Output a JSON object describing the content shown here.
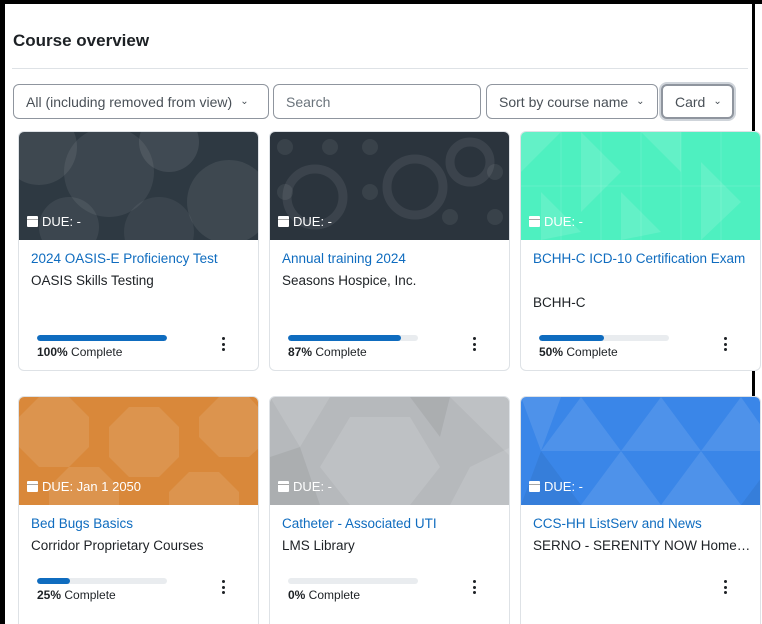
{
  "page": {
    "title": "Course overview"
  },
  "controls": {
    "filter_label": "All (including removed from view)",
    "search_placeholder": "Search",
    "sort_label": "Sort by course name",
    "view_label": "Card"
  },
  "colors": {
    "link": "#0f6cbf",
    "progress_fill": "#0f6cbf",
    "progress_track": "#e9ecef"
  },
  "courses": [
    {
      "due": "DUE: -",
      "title": "2024 OASIS-E Proficiency Test",
      "category": "OASIS Skills Testing",
      "progress_pct": "100%",
      "progress_suffix": " Complete",
      "progress": 100,
      "image_color": "#2e3942",
      "icon": "calendar-icon"
    },
    {
      "due": "DUE: -",
      "title": "Annual training 2024",
      "category": "Seasons Hospice, Inc.",
      "progress_pct": "87%",
      "progress_suffix": " Complete",
      "progress": 87,
      "image_color": "#2b343d",
      "icon": "calendar-icon"
    },
    {
      "due": "DUE: -",
      "title": "BCHH-C ICD-10 Certification Exam",
      "category": "BCHH-C",
      "progress_pct": "50%",
      "progress_suffix": " Complete",
      "progress": 50,
      "image_color": "#4ef0c0",
      "icon": "calendar-icon"
    },
    {
      "due": "DUE: Jan 1 2050",
      "title": "Bed Bugs Basics",
      "category": "Corridor Proprietary Courses",
      "progress_pct": "25%",
      "progress_suffix": " Complete",
      "progress": 25,
      "image_color": "#d9883a",
      "icon": "calendar-icon"
    },
    {
      "due": "DUE: -",
      "title": "Catheter - Associated UTI",
      "category": "LMS Library",
      "progress_pct": "0%",
      "progress_suffix": " Complete",
      "progress": 0,
      "image_color": "#b6b9bc",
      "icon": "calendar-icon"
    },
    {
      "due": "DUE: -",
      "title": "CCS-HH ListServ and News",
      "category": "SERNO - SERENITY NOW Home ...",
      "image_color": "#3a86e8",
      "icon": "calendar-icon"
    }
  ]
}
